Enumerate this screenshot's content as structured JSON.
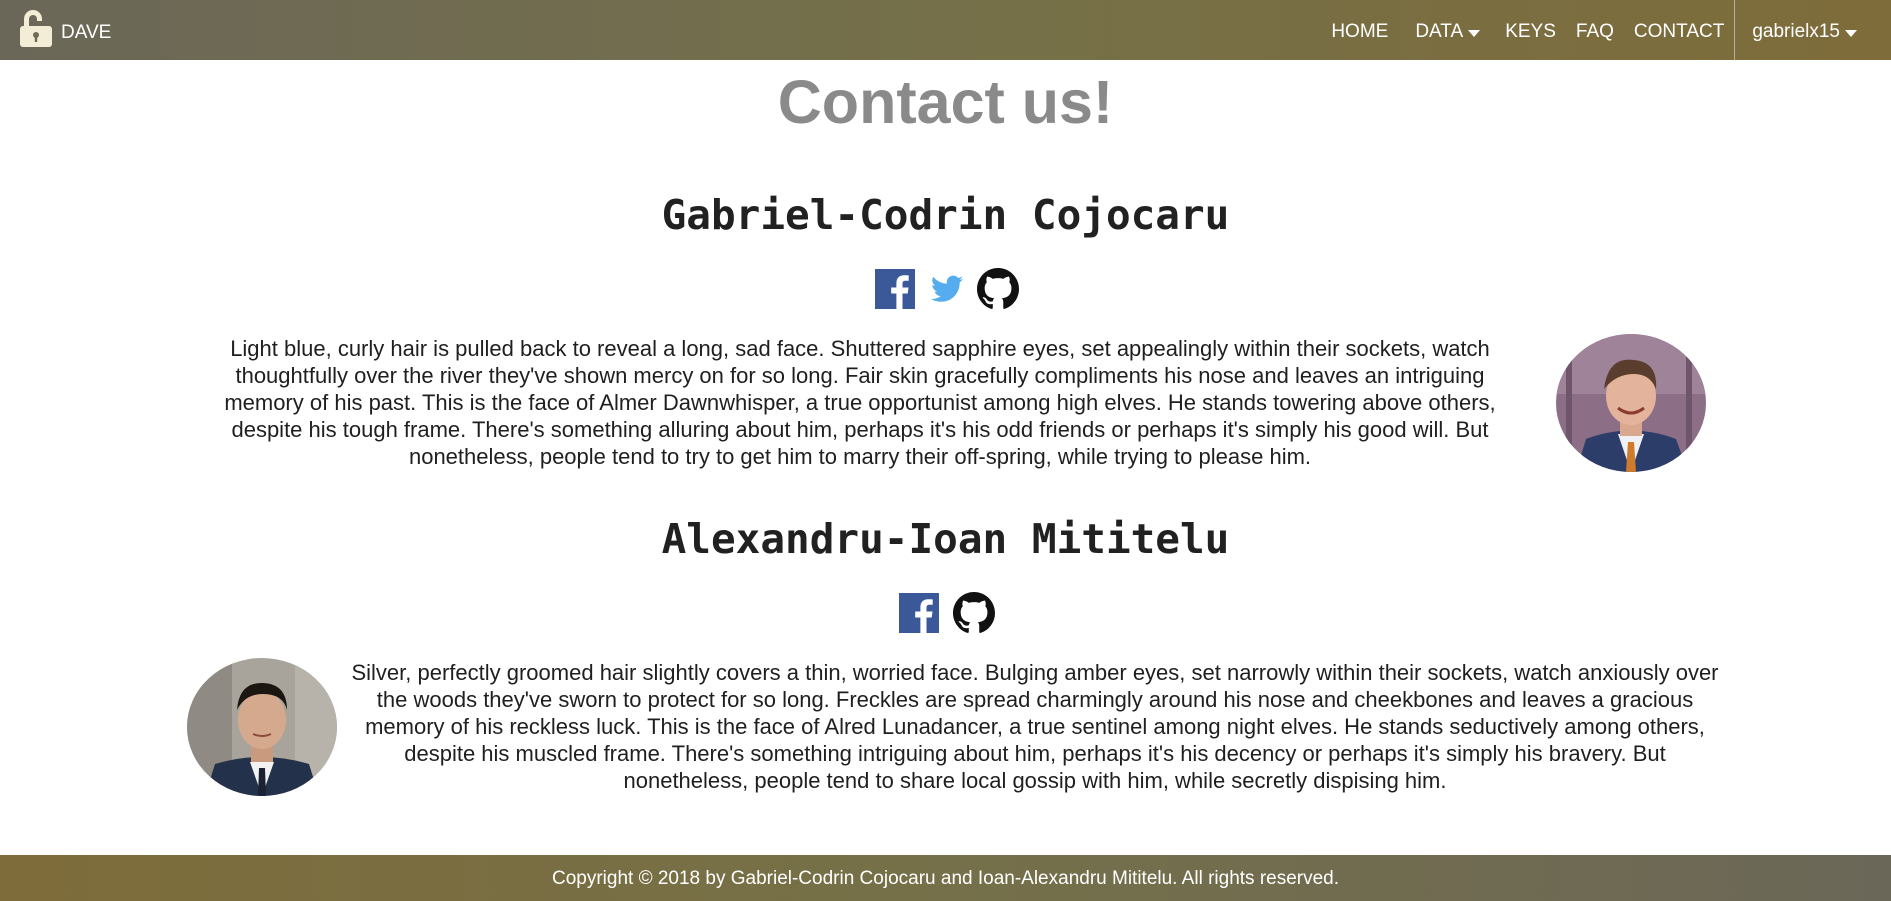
{
  "app": {
    "brand": "DAVE"
  },
  "nav": {
    "home": "HOME",
    "data": "DATA",
    "keys": "KEYS",
    "faq": "FAQ",
    "contact": "CONTACT",
    "user": "gabrielx15"
  },
  "page": {
    "title": "Contact us!"
  },
  "people": [
    {
      "name": "Gabriel-Codrin Cojocaru",
      "socials": [
        "facebook-icon",
        "twitter-icon",
        "github-icon"
      ],
      "bio": "Light blue, curly hair is pulled back to reveal a long, sad face. Shuttered sapphire eyes, set appealingly within their sockets, watch thoughtfully over the river they've shown mercy on for so long. Fair skin gracefully compliments his nose and leaves an intriguing memory of his past. This is the face of Almer Dawnwhisper, a true opportunist among high elves. He stands towering above others, despite his tough frame. There's something alluring about him, perhaps it's his odd friends or perhaps it's simply his good will. But nonetheless, people tend to try to get him to marry their off-spring, while trying to please him."
    },
    {
      "name": "Alexandru-Ioan Mititelu",
      "socials": [
        "facebook-icon",
        "github-icon"
      ],
      "bio": "Silver, perfectly groomed hair slightly covers a thin, worried face. Bulging amber eyes, set narrowly within their sockets, watch anxiously over the woods they've sworn to protect for so long. Freckles are spread charmingly around his nose and cheekbones and leaves a gracious memory of his reckless luck. This is the face of Alred Lunadancer, a true sentinel among night elves. He stands seductively among others, despite his muscled frame. There's something intriguing about him, perhaps it's his decency or perhaps it's simply his bravery. But nonetheless, people tend to share local gossip with him, while secretly dispising him."
    }
  ],
  "footer": {
    "text": "Copyright © 2018 by Gabriel-Codrin Cojocaru and Ioan-Alexandru Mititelu. All rights reserved."
  },
  "colors": {
    "nav_gradient_start": "#6b6758",
    "nav_gradient_end": "#7e6c3a",
    "title_gray": "#8a8a8a",
    "facebook": "#3b5998",
    "twitter": "#55acee",
    "github": "#111111"
  }
}
